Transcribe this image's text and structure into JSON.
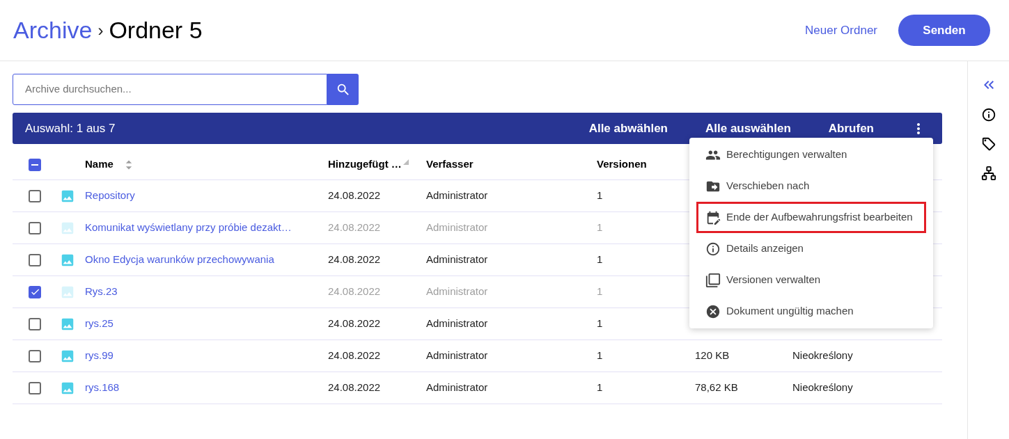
{
  "breadcrumb": {
    "root": "Archive",
    "separator": "›",
    "current": "Ordner 5"
  },
  "actions": {
    "new_folder": "Neuer Ordner",
    "send": "Senden"
  },
  "search": {
    "placeholder": "Archive durchsuchen..."
  },
  "selection_bar": {
    "count": "Auswahl: 1 aus 7",
    "buttons": [
      "Alle abwählen",
      "Alle auswählen",
      "Abrufen"
    ]
  },
  "table": {
    "select_all": {
      "checked": true,
      "indeterminate": true
    },
    "columns": [
      {
        "label": "Name",
        "sortable": true
      },
      {
        "label": "Hinzugefügt …",
        "sortable": true
      },
      {
        "label": "Verfasser",
        "sortable": false
      },
      {
        "label": "Versionen",
        "sortable": false
      }
    ],
    "rows": [
      {
        "name": "Repository",
        "date": "24.08.2022",
        "author": "Administrator",
        "versions": "1",
        "checked": false,
        "disabled": false
      },
      {
        "name": "Komunikat wyświetlany przy próbie dezakt…",
        "date": "24.08.2022",
        "author": "Administrator",
        "versions": "1",
        "checked": false,
        "disabled": true
      },
      {
        "name": "Okno Edycja warunków przechowywania",
        "date": "24.08.2022",
        "author": "Administrator",
        "versions": "1",
        "checked": false,
        "disabled": false
      },
      {
        "name": "Rys.23",
        "date": "24.08.2022",
        "author": "Administrator",
        "versions": "1",
        "checked": true,
        "disabled": true
      },
      {
        "name": "rys.25",
        "date": "24.08.2022",
        "author": "Administrator",
        "versions": "1",
        "checked": false,
        "disabled": false
      },
      {
        "name": "rys.99",
        "date": "24.08.2022",
        "author": "Administrator",
        "versions": "1",
        "size": "120 KB",
        "status": "Nieokreślony",
        "checked": false,
        "disabled": false
      },
      {
        "name": "rys.168",
        "date": "24.08.2022",
        "author": "Administrator",
        "versions": "1",
        "size": "78,62 KB",
        "status": "Nieokreślony",
        "checked": false,
        "disabled": false
      }
    ]
  },
  "context_menu": [
    {
      "label": "Berechtigungen verwalten",
      "highlighted": false
    },
    {
      "label": "Verschieben nach",
      "highlighted": false
    },
    {
      "label": "Ende der Aufbewahrungsfrist bearbeiten",
      "highlighted": true
    },
    {
      "label": "Details anzeigen",
      "highlighted": false
    },
    {
      "label": "Versionen verwalten",
      "highlighted": false
    },
    {
      "label": "Dokument ungültig machen",
      "highlighted": false
    }
  ]
}
